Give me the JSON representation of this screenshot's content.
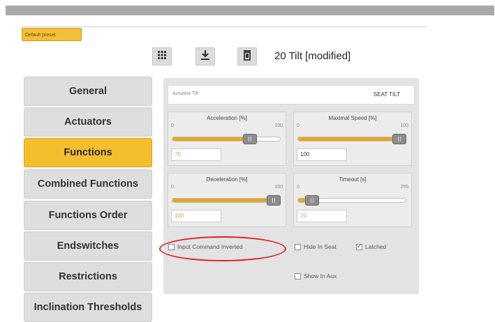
{
  "tab": {
    "label": "Default preset"
  },
  "toolbar": {
    "grid_icon": "grid-icon",
    "download_icon": "download-icon",
    "delete_icon": "trash-icon",
    "title": "20 Tilt [modified]"
  },
  "sidebar": {
    "items": [
      {
        "label": "General",
        "active": false
      },
      {
        "label": "Actuators",
        "active": false
      },
      {
        "label": "Functions",
        "active": true
      },
      {
        "label": "Combined Functions",
        "active": false
      },
      {
        "label": "Functions Order",
        "active": false
      },
      {
        "label": "Endswitches",
        "active": false
      },
      {
        "label": "Restrictions",
        "active": false
      },
      {
        "label": "Inclination Thresholds",
        "active": false
      }
    ]
  },
  "function": {
    "actuator_label": "Actuator Tilt",
    "name": "SEAT TILT",
    "sliders": [
      {
        "title": "Acceleration [%]",
        "min": "0",
        "max": "100",
        "value": 75,
        "field": "75"
      },
      {
        "title": "Maximal Speed [%]",
        "min": "0",
        "max": "100",
        "value": 100,
        "field": "100"
      },
      {
        "title": "Deceleration [%]",
        "min": "0",
        "max": "100",
        "value": 100,
        "field": "100"
      },
      {
        "title": "Timeout [s]",
        "min": "0",
        "max": "255",
        "value": 20,
        "field": "20"
      }
    ],
    "checkboxes": [
      {
        "label": "Input Command Inverted",
        "checked": false
      },
      {
        "label": "Hide In Seat",
        "checked": false
      },
      {
        "label": "Latched",
        "checked": true
      },
      {
        "label": "Show In Aux",
        "checked": false
      }
    ]
  },
  "colors": {
    "accent": "#f4be2f",
    "slider_fill": "#e5a623",
    "highlight": "#e02020"
  }
}
